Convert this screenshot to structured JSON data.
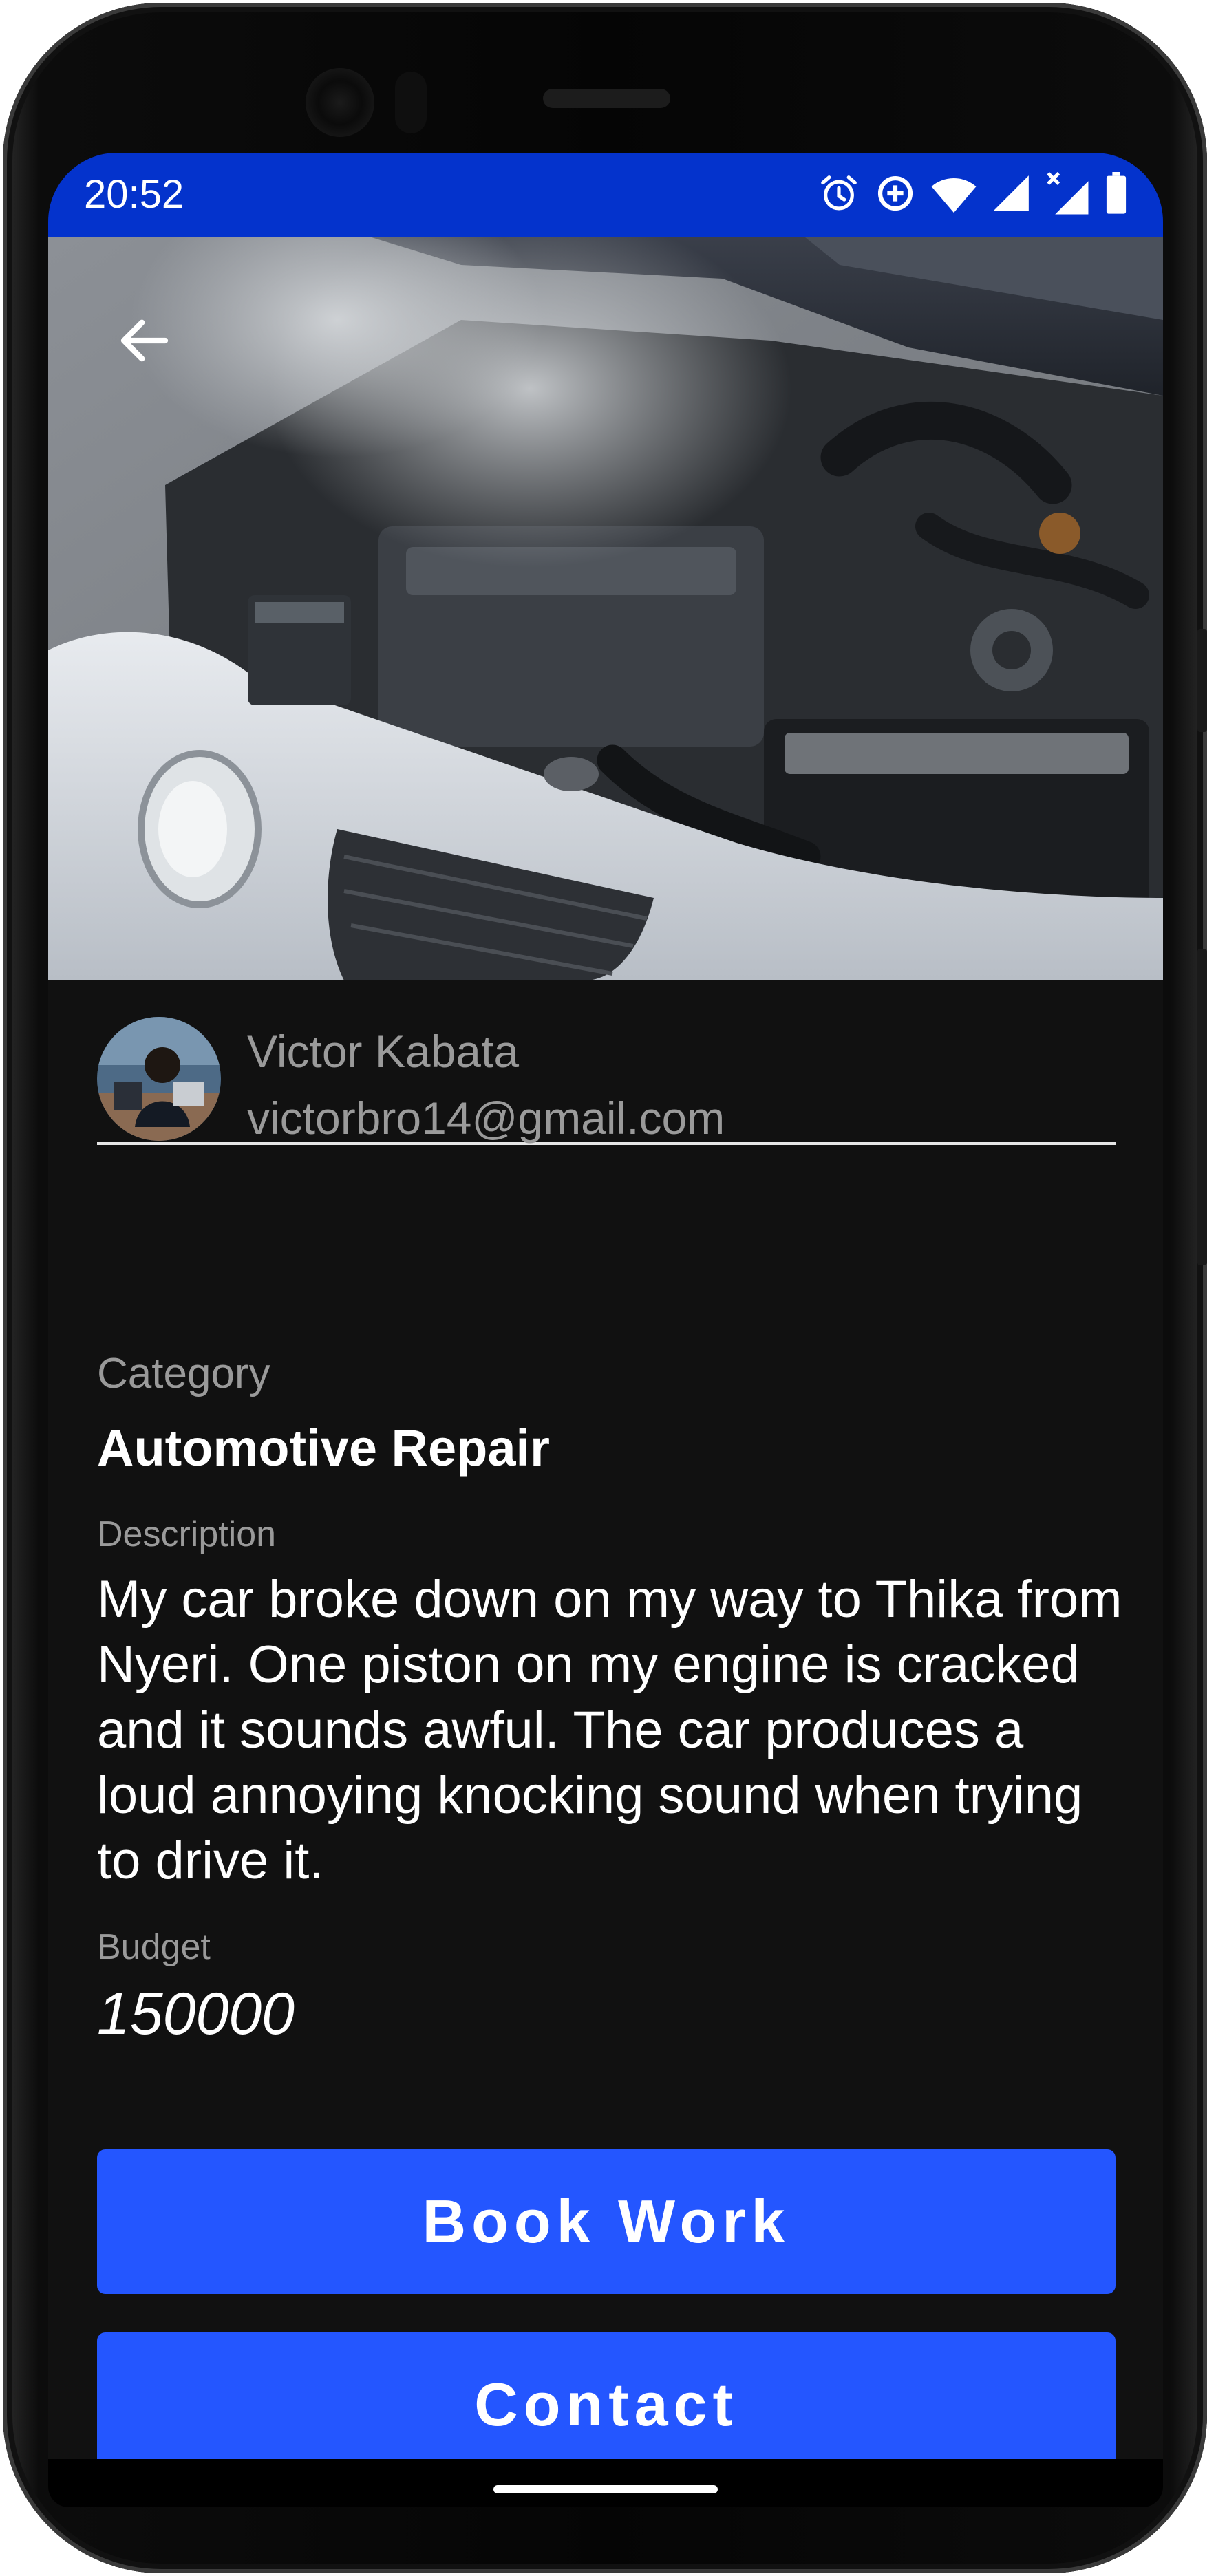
{
  "status_bar": {
    "time": "20:52",
    "icons": [
      "alarm-icon",
      "data-saver-icon",
      "wifi-icon",
      "signal-icon",
      "signal-no-data-icon",
      "battery-icon"
    ],
    "color": "#0433cc"
  },
  "hero": {
    "image": "car-engine-photo",
    "back_icon": "back-arrow-icon"
  },
  "owner": {
    "name": "Victor Kabata",
    "email": "victorbro14@gmail.com"
  },
  "details": {
    "category_label": "Category",
    "category_value": "Automotive Repair",
    "description_label": "Description",
    "description_text": "My car broke down on my way to Thika from Nyeri. One piston on my engine is cracked and it sounds awful. The car produces a loud annoying knocking sound when trying to drive it.",
    "budget_label": "Budget",
    "budget_value": "150000"
  },
  "actions": {
    "book_label": "Book Work",
    "contact_label": "Contact",
    "button_color": "#2456ff"
  }
}
